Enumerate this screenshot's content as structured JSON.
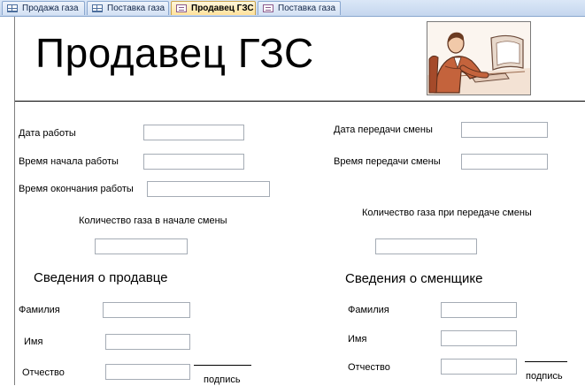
{
  "tabs": [
    {
      "label": "Продажа газа",
      "icon": "table-icon",
      "active": false
    },
    {
      "label": "Поставка газа",
      "icon": "table-icon",
      "active": false
    },
    {
      "label": "Продавец ГЗС",
      "icon": "form-icon",
      "active": true
    },
    {
      "label": "Поставка газа",
      "icon": "form-icon",
      "active": false
    }
  ],
  "form": {
    "title": "Продавец ГЗС",
    "picture": "seller-at-computer-clipart",
    "fields": {
      "work_date": "Дата работы",
      "start_time": "Время начала работы",
      "end_time": "Время окончания работы",
      "handover_date": "Дата передачи смены",
      "handover_time": "Время передачи смены",
      "gas_start": "Количество газа в начале смены",
      "gas_handover": "Количество газа при передаче смены"
    },
    "seller": {
      "heading": "Сведения о продавце",
      "surname": "Фамилия",
      "name": "Имя",
      "patronymic": "Отчество",
      "signature": "подпись"
    },
    "replacement": {
      "heading": "Сведения о сменщике",
      "surname": "Фамилия",
      "name": "Имя",
      "patronymic": "Отчество",
      "signature": "подпись"
    }
  }
}
